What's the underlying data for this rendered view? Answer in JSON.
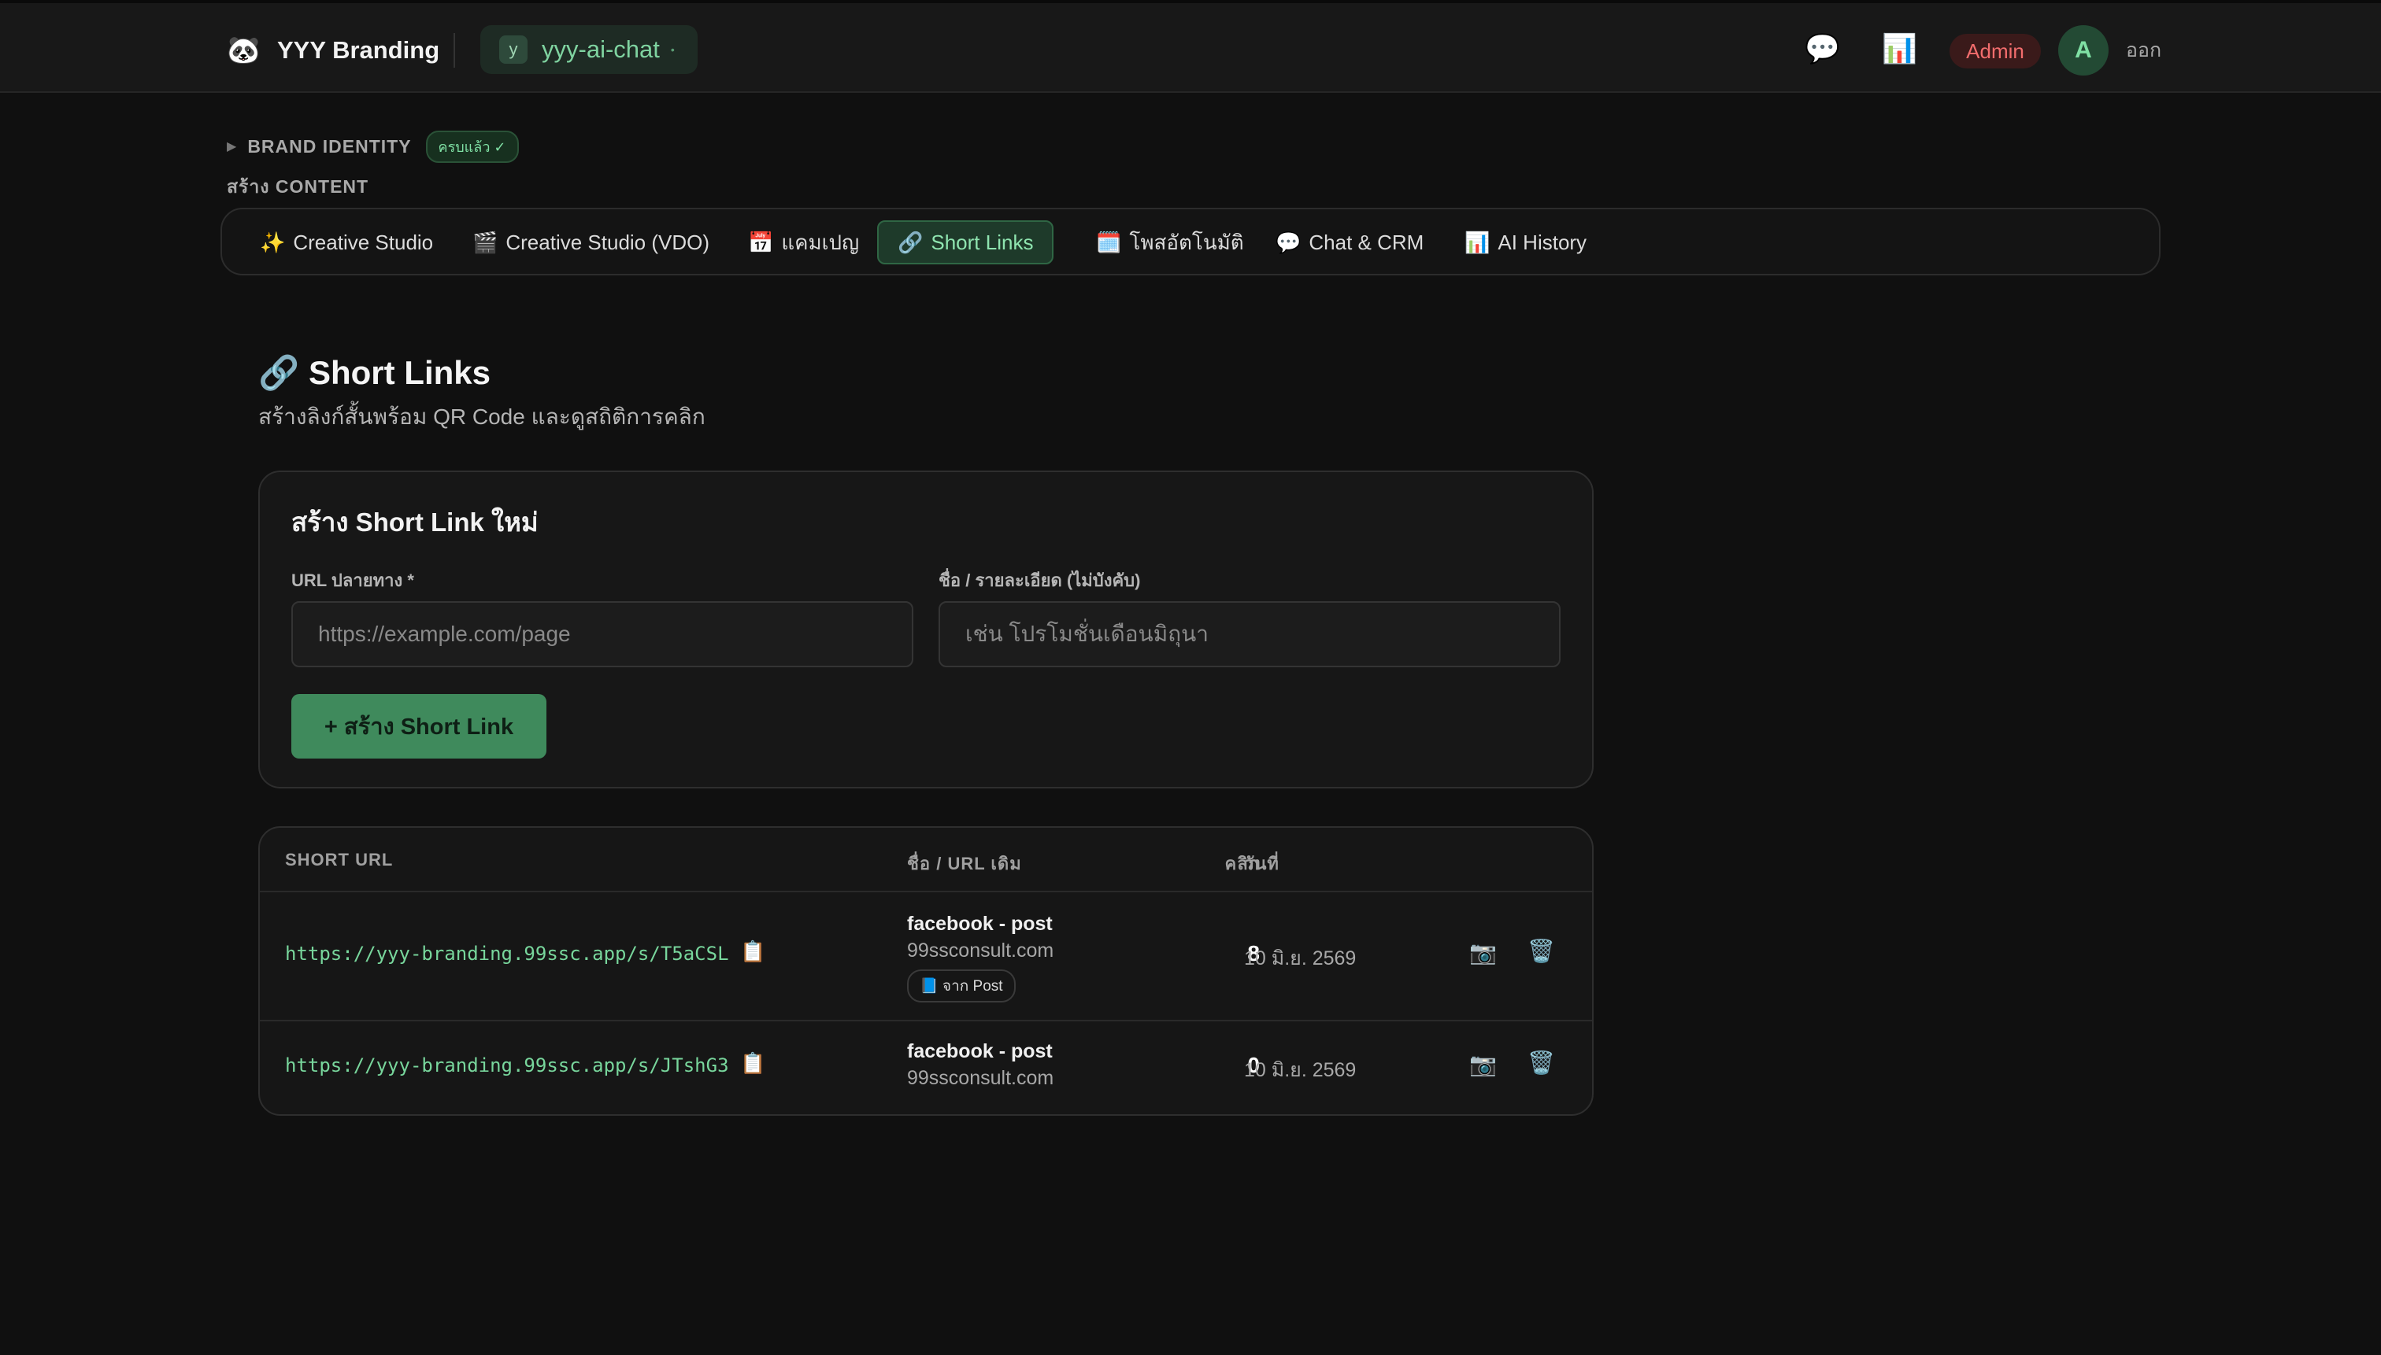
{
  "header": {
    "logo_icon": "🐼",
    "brand": "YYY Branding",
    "workspace_initial": "y",
    "workspace_name": "yyy-ai-chat",
    "workspace_dot": "•",
    "chat_icon": "💬",
    "stats_icon": "📊",
    "admin_label": "Admin",
    "user_initial": "A",
    "logout_label": "ออก"
  },
  "brand_identity": {
    "label": "BRAND IDENTITY",
    "badge": "ครบแล้ว ✓"
  },
  "create_content_label": "สร้าง CONTENT",
  "tabs": [
    {
      "icon": "✨",
      "label": "Creative Studio"
    },
    {
      "icon": "🎬",
      "label": "Creative Studio (VDO)"
    },
    {
      "icon": "📅",
      "label": "แคมเปญ"
    },
    {
      "icon": "🔗",
      "label": "Short Links"
    },
    {
      "icon": "🗓️",
      "label": "โพสอัตโนมัติ"
    },
    {
      "icon": "💬",
      "label": "Chat & CRM"
    },
    {
      "icon": "📊",
      "label": "AI History"
    }
  ],
  "page": {
    "title_icon": "🔗",
    "title": "Short Links",
    "subtitle": "สร้างลิงก์สั้นพร้อม QR Code และดูสถิติการคลิก"
  },
  "form": {
    "title": "สร้าง Short Link ใหม่",
    "url_label": "URL ปลายทาง *",
    "url_placeholder": "https://example.com/page",
    "url_value": "",
    "name_label": "ชื่อ / รายละเอียด (ไม่บังคับ)",
    "name_placeholder": "เช่น โปรโมชั่นเดือนมิถุนา",
    "name_value": "",
    "submit_label": "+ สร้าง Short Link"
  },
  "table": {
    "columns": [
      "SHORT URL",
      "ชื่อ / URL เดิม",
      "คลิก",
      "วันที่"
    ],
    "rows": [
      {
        "short_url": "https://yyy-branding.99ssc.app/s/T5aCSL",
        "copy_icon": "📋",
        "name": "facebook - post",
        "original": "99ssconsult.com",
        "source": "📘 จาก Post",
        "clicks": "8",
        "date": "10 มิ.ย. 2569",
        "qr_icon": "📷",
        "delete_icon": "🗑️"
      },
      {
        "short_url": "https://yyy-branding.99ssc.app/s/JTshG3",
        "copy_icon": "📋",
        "name": "facebook - post",
        "original": "99ssconsult.com",
        "source": "",
        "clicks": "0",
        "date": "10 มิ.ย. 2569",
        "qr_icon": "📷",
        "delete_icon": "🗑️"
      }
    ]
  }
}
